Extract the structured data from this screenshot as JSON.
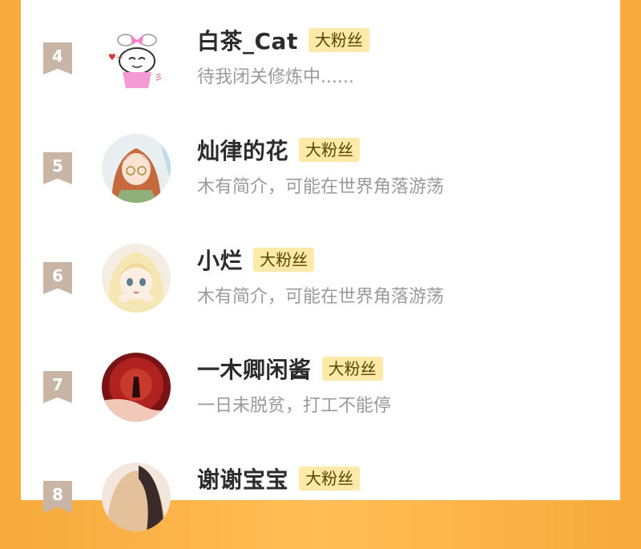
{
  "fans": [
    {
      "rank": "4",
      "name": "白茶_Cat",
      "badge": "大粉丝",
      "bio": "待我闭关修炼中......",
      "avatar": "bunny-avatar-icon"
    },
    {
      "rank": "5",
      "name": "灿律的花",
      "badge": "大粉丝",
      "bio": "木有简介，可能在世界角落游荡",
      "avatar": "orange-hair-girl-avatar"
    },
    {
      "rank": "6",
      "name": "小烂",
      "badge": "大粉丝",
      "bio": "木有简介，可能在世界角落游荡",
      "avatar": "blonde-girl-avatar"
    },
    {
      "rank": "7",
      "name": "一木卿闲酱",
      "badge": "大粉丝",
      "bio": "一日未脱贫，打工不能停",
      "avatar": "red-scene-avatar"
    },
    {
      "rank": "8",
      "name": "谢谢宝宝",
      "badge": "大粉丝",
      "bio": "",
      "avatar": "anime-girl-avatar"
    }
  ],
  "colors": {
    "accent": "#f7a93a",
    "badge_bg": "#fde9a8",
    "rank_bg": "#c8b5a5"
  }
}
